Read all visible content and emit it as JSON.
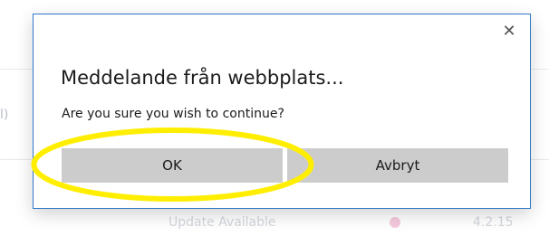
{
  "background": {
    "left_fragment": "l)",
    "bottom_fragment_1": "Update Available",
    "bottom_fragment_2": "4.2.15"
  },
  "dialog": {
    "close_glyph": "✕",
    "title": "Meddelande från webbplats...",
    "message": "Are you sure you wish to continue?",
    "ok_label": "OK",
    "cancel_label": "Avbryt",
    "border_color": "#2f79c9",
    "button_color": "#cccccc"
  },
  "annotation": {
    "highlight_color": "#ffee00",
    "highlighted": "ok-button"
  }
}
